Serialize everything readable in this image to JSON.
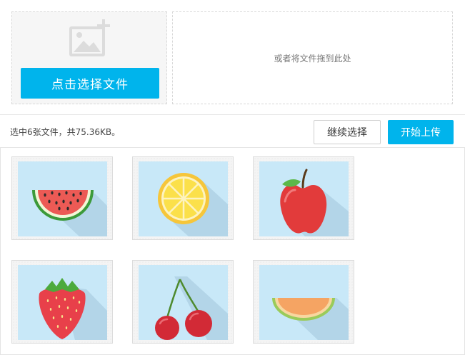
{
  "picker": {
    "button_label": "点击选择文件",
    "icon": "image-add-icon"
  },
  "dropzone": {
    "hint": "或者将文件拖到此处"
  },
  "status": {
    "summary": "选中6张文件，共75.36KB。",
    "continue_label": "继续选择",
    "upload_label": "开始上传"
  },
  "files": [
    {
      "icon": "watermelon-icon"
    },
    {
      "icon": "lemon-icon"
    },
    {
      "icon": "apple-icon"
    },
    {
      "icon": "strawberry-icon"
    },
    {
      "icon": "cherry-icon"
    },
    {
      "icon": "cantaloupe-icon"
    }
  ],
  "colors": {
    "accent": "#00b4ec",
    "thumb_bg": "#c8e8f8",
    "shadow": "#b3d5e8"
  }
}
